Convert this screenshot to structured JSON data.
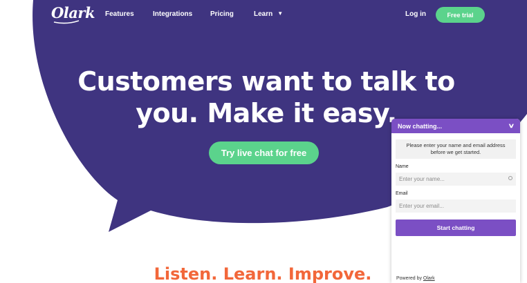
{
  "colors": {
    "brand_purple": "#3f3480",
    "cta_green": "#5bd38c",
    "tagline_orange": "#f2673a",
    "chat_purple": "#7b4fc4"
  },
  "nav": {
    "logo": "Olark",
    "links": [
      "Features",
      "Integrations",
      "Pricing",
      "Learn"
    ],
    "login": "Log in",
    "free_trial": "Free trial"
  },
  "hero": {
    "headline_line1": "Customers want to talk to",
    "headline_line2": "you. Make it easy.",
    "cta": "Try live chat for free"
  },
  "tagline": "Listen. Learn. Improve.",
  "chat": {
    "header": "Now chatting...",
    "header_icon": "chevron-down-icon",
    "intro": "Please enter your name and email address before we get started.",
    "name_label": "Name",
    "name_placeholder": "Enter your name...",
    "email_label": "Email",
    "email_placeholder": "Enter your email...",
    "submit": "Start chatting",
    "powered_prefix": "Powered by",
    "powered_link": "Olark"
  }
}
